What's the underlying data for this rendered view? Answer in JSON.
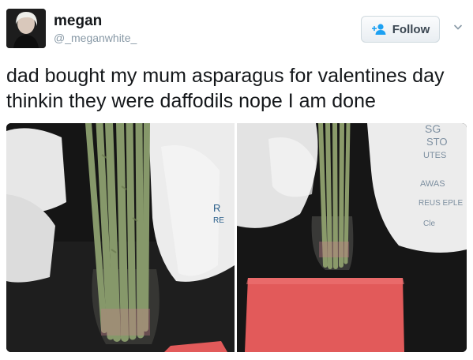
{
  "user": {
    "name": "megan",
    "handle": "@_meganwhite_"
  },
  "follow": {
    "label": "Follow",
    "icon": "add-user-icon",
    "caret_icon": "chevron-down-icon"
  },
  "tweet": {
    "text": "dad bought my mum asparagus for valentines day thinkin they were daffodils nope I am done"
  },
  "media": {
    "photos": [
      "asparagus-closeup",
      "asparagus-on-table"
    ]
  },
  "colors": {
    "name": "#14171a",
    "handle": "#8899a6",
    "follow_text": "#3a4651",
    "asparagus": "#8a9a6a",
    "red_paper": "#e25a5a"
  }
}
